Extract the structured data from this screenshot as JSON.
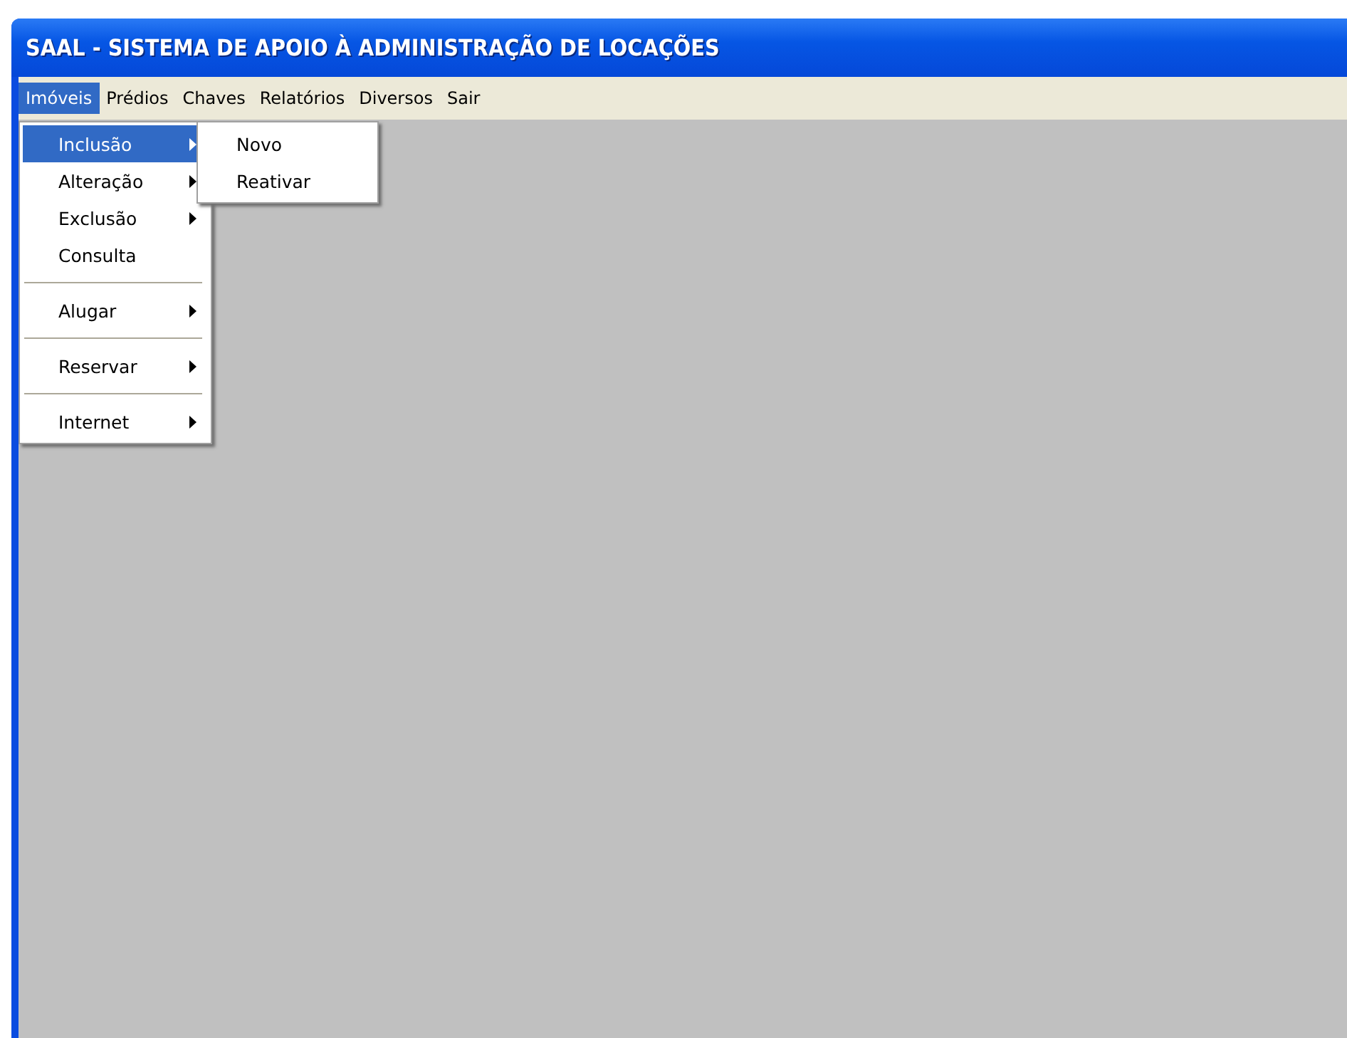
{
  "window": {
    "title": "SAAL - SISTEMA DE APOIO À ADMINISTRAÇÃO DE LOCAÇÕES"
  },
  "menubar": [
    {
      "label": "Imóveis",
      "selected": true
    },
    {
      "label": "Prédios",
      "selected": false
    },
    {
      "label": "Chaves",
      "selected": false
    },
    {
      "label": "Relatórios",
      "selected": false
    },
    {
      "label": "Diversos",
      "selected": false
    },
    {
      "label": "Sair",
      "selected": false
    }
  ],
  "menu": [
    {
      "kind": "item",
      "label": "Inclusão",
      "submenu": true,
      "selected": true
    },
    {
      "kind": "item",
      "label": "Alteração",
      "submenu": true,
      "selected": false
    },
    {
      "kind": "item",
      "label": "Exclusão",
      "submenu": true,
      "selected": false
    },
    {
      "kind": "item",
      "label": "Consulta",
      "submenu": false,
      "selected": false
    },
    {
      "kind": "separator"
    },
    {
      "kind": "item",
      "label": "Alugar",
      "submenu": true,
      "selected": false
    },
    {
      "kind": "separator"
    },
    {
      "kind": "item",
      "label": "Reservar",
      "submenu": true,
      "selected": false
    },
    {
      "kind": "separator"
    },
    {
      "kind": "item",
      "label": "Internet",
      "submenu": true,
      "selected": false
    }
  ],
  "submenu": [
    {
      "label": "Novo",
      "selected": false
    },
    {
      "label": "Reativar",
      "selected": false
    }
  ]
}
